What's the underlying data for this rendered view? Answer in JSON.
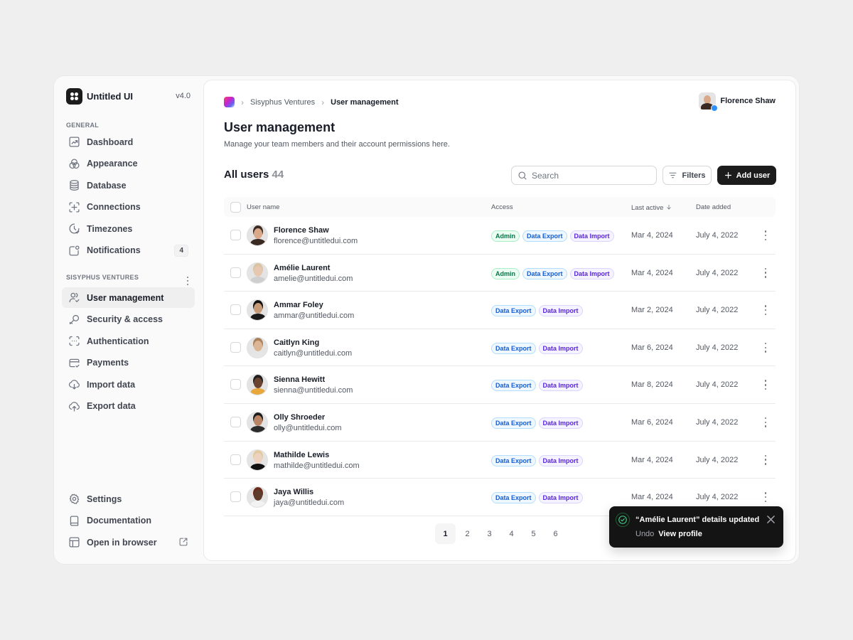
{
  "app": {
    "name": "Untitled UI",
    "version": "v4.0"
  },
  "sidebar": {
    "general_label": "GENERAL",
    "general_items": [
      {
        "label": "Dashboard",
        "icon": "chart-icon"
      },
      {
        "label": "Appearance",
        "icon": "circles-icon"
      },
      {
        "label": "Database",
        "icon": "database-icon"
      },
      {
        "label": "Connections",
        "icon": "connections-icon"
      },
      {
        "label": "Timezones",
        "icon": "clock-icon"
      },
      {
        "label": "Notifications",
        "icon": "notification-icon",
        "badge": "4"
      }
    ],
    "workspace_label": "SISYPHUS VENTURES",
    "workspace_items": [
      {
        "label": "User management",
        "icon": "users-icon",
        "active": true
      },
      {
        "label": "Security & access",
        "icon": "key-icon"
      },
      {
        "label": "Authentication",
        "icon": "passcode-icon"
      },
      {
        "label": "Payments",
        "icon": "credit-card-icon"
      },
      {
        "label": "Import data",
        "icon": "cloud-download-icon"
      },
      {
        "label": "Export data",
        "icon": "cloud-upload-icon"
      }
    ],
    "footer_items": [
      {
        "label": "Settings",
        "icon": "gear-icon"
      },
      {
        "label": "Documentation",
        "icon": "book-icon"
      },
      {
        "label": "Open in browser",
        "icon": "browser-icon"
      }
    ]
  },
  "breadcrumb": {
    "items": [
      "Sisyphus Ventures",
      "User management"
    ]
  },
  "current_user": {
    "name": "Florence Shaw",
    "verified": true
  },
  "header": {
    "title": "User management",
    "subtitle": "Manage your team members and their account permissions here."
  },
  "toolbar": {
    "all_users_label": "All users",
    "user_count": "44",
    "search_placeholder": "Search",
    "search_value": "",
    "filters_label": "Filters",
    "add_user_label": "Add user"
  },
  "table": {
    "columns": {
      "user_name": "User name",
      "access": "Access",
      "last_active": "Last active",
      "date_added": "Date added"
    },
    "sort": {
      "column": "last_active",
      "direction": "descending"
    },
    "rows": [
      {
        "name": "Florence Shaw",
        "email": "florence@untitledui.com",
        "access": [
          "Admin",
          "Data Export",
          "Data Import"
        ],
        "last_active": "Mar 4, 2024",
        "date_added": "July 4, 2022"
      },
      {
        "name": "Amélie Laurent",
        "email": "amelie@untitledui.com",
        "access": [
          "Admin",
          "Data Export",
          "Data Import"
        ],
        "last_active": "Mar 4, 2024",
        "date_added": "July 4, 2022"
      },
      {
        "name": "Ammar Foley",
        "email": "ammar@untitledui.com",
        "access": [
          "Data Export",
          "Data Import"
        ],
        "last_active": "Mar 2, 2024",
        "date_added": "July 4, 2022"
      },
      {
        "name": "Caitlyn King",
        "email": "caitlyn@untitledui.com",
        "access": [
          "Data Export",
          "Data Import"
        ],
        "last_active": "Mar 6, 2024",
        "date_added": "July 4, 2022"
      },
      {
        "name": "Sienna Hewitt",
        "email": "sienna@untitledui.com",
        "access": [
          "Data Export",
          "Data Import"
        ],
        "last_active": "Mar 8, 2024",
        "date_added": "July 4, 2022"
      },
      {
        "name": "Olly Shroeder",
        "email": "olly@untitledui.com",
        "access": [
          "Data Export",
          "Data Import"
        ],
        "last_active": "Mar 6, 2024",
        "date_added": "July 4, 2022"
      },
      {
        "name": "Mathilde Lewis",
        "email": "mathilde@untitledui.com",
        "access": [
          "Data Export",
          "Data Import"
        ],
        "last_active": "Mar 4, 2024",
        "date_added": "July 4, 2022"
      },
      {
        "name": "Jaya Willis",
        "email": "jaya@untitledui.com",
        "access": [
          "Data Export",
          "Data Import"
        ],
        "last_active": "Mar 4, 2024",
        "date_added": "July 4, 2022"
      }
    ]
  },
  "pagination": {
    "pages": [
      "1",
      "2",
      "3",
      "4",
      "5",
      "6"
    ],
    "current": "1"
  },
  "toast": {
    "title": "“Amélie Laurent” details updated",
    "undo_label": "Undo",
    "view_label": "View profile"
  },
  "colors": {
    "primary_button": "#1c1c1c",
    "badge_admin": "#067647",
    "badge_export": "#175cd3",
    "badge_import": "#5925dc",
    "toast_success": "#47cd89"
  }
}
